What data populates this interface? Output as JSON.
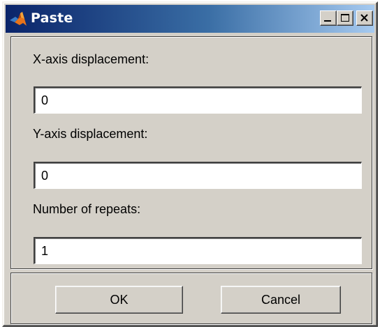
{
  "window": {
    "title": "Paste",
    "icon": "matlab-logo-icon"
  },
  "titlebar_buttons": [
    "minimize-icon",
    "maximize-icon",
    "close-icon"
  ],
  "form": {
    "x_label": "X-axis displacement:",
    "x_value": "0",
    "y_label": "Y-axis displacement:",
    "y_value": "0",
    "repeats_label": "Number of repeats:",
    "repeats_value": "1"
  },
  "buttons": {
    "ok": "OK",
    "cancel": "Cancel"
  },
  "colors": {
    "titlebar_start": "#0a246a",
    "titlebar_end": "#a6caf0",
    "dialog_face": "#d4d0c8"
  }
}
